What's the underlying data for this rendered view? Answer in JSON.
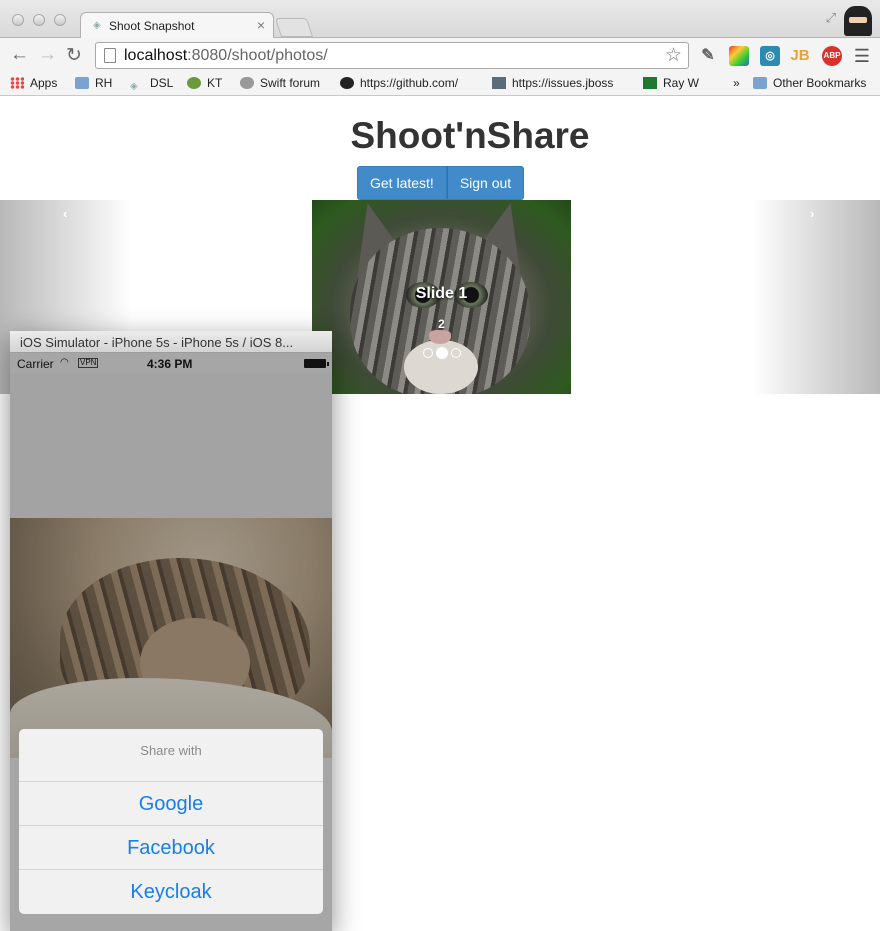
{
  "browser": {
    "tab_title": "Shoot Snapshot",
    "tab_close": "×",
    "url_host": "localhost",
    "url_path": ":8080/shoot/photos/",
    "bookmarks": [
      {
        "label": "Apps",
        "icon": "apps-grid-icon"
      },
      {
        "label": "RH",
        "icon": "folder-icon"
      },
      {
        "label": "DSL",
        "icon": "web-icon"
      },
      {
        "label": "KT",
        "icon": "kotlin-icon"
      },
      {
        "label": "Swift forum",
        "icon": "apple-icon"
      },
      {
        "label": "https://github.com/",
        "icon": "github-icon"
      },
      {
        "label": "https://issues.jboss",
        "icon": "jboss-icon"
      },
      {
        "label": "Ray W",
        "icon": "raywenderlich-icon"
      },
      {
        "label": "Other Bookmarks",
        "icon": "folder-icon"
      }
    ],
    "overflow": "»",
    "extensions": [
      {
        "name": "eyedropper-icon"
      },
      {
        "name": "colorzilla-icon"
      },
      {
        "name": "swirl-icon"
      },
      {
        "name": "jb-icon",
        "label": "JB"
      },
      {
        "name": "adblock-icon",
        "label": "ABP"
      }
    ]
  },
  "page": {
    "title": "Shoot'nShare",
    "buttons": {
      "get_latest": "Get latest!",
      "sign_out": "Sign out"
    },
    "carousel": {
      "prev": "‹",
      "next": "›",
      "caption": "Slide 1",
      "caption_sub": "2",
      "indicator_count": 3,
      "active_index": 1
    }
  },
  "simulator": {
    "window_title": "iOS Simulator - iPhone 5s - iPhone 5s / iOS 8...",
    "status": {
      "carrier": "Carrier",
      "vpn": "VPN",
      "time": "4:36 PM"
    },
    "sheet": {
      "title": "Share with",
      "options": [
        "Google",
        "Facebook",
        "Keycloak"
      ]
    }
  },
  "colors": {
    "primary_button": "#428bca",
    "ios_link": "#1a7ee8"
  }
}
